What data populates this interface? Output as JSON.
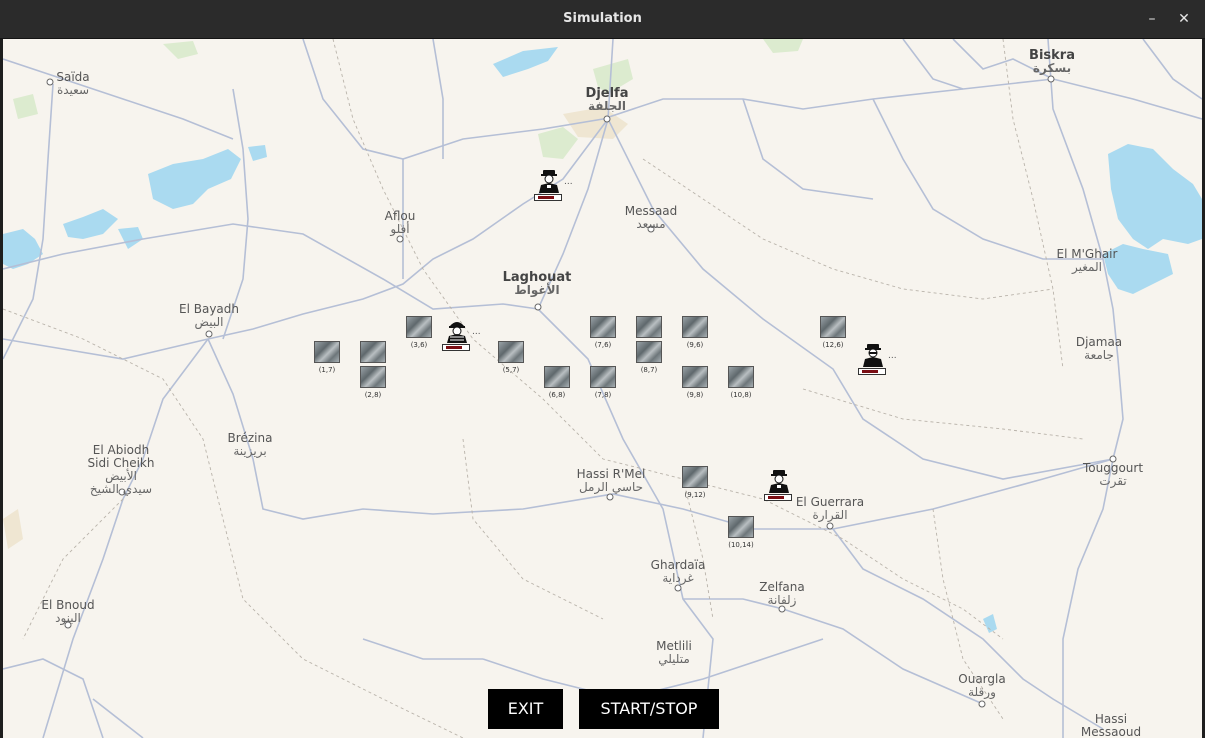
{
  "window": {
    "title": "Simulation",
    "minimize_icon": "–",
    "close_icon": "✕"
  },
  "buttons": {
    "exit": "EXIT",
    "start_stop": "START/STOP"
  },
  "cities": {
    "saida": {
      "name": "Saïda",
      "ar": "سعيدة"
    },
    "djelfa": {
      "name": "Djelfa",
      "ar": "الجلفة"
    },
    "biskra": {
      "name": "Biskra",
      "ar": "بسكرة"
    },
    "aflou": {
      "name": "Aflou",
      "ar": "أفلو"
    },
    "messaad": {
      "name": "Messaad",
      "ar": "مسعد"
    },
    "laghouat": {
      "name": "Laghouat",
      "ar": "الأغواط"
    },
    "elmghair": {
      "name": "El M'Ghair",
      "ar": "المغير"
    },
    "elbayadh": {
      "name": "El Bayadh",
      "ar": "البيض"
    },
    "djamaa": {
      "name": "Djamaa",
      "ar": "جامعة"
    },
    "elabiodh": {
      "name": "El Abiodh\nSidi Cheikh",
      "ar": "الأبيض\nسيدي الشيخ"
    },
    "brezina": {
      "name": "Brézina",
      "ar": "بريزينة"
    },
    "hassirmel": {
      "name": "Hassi R'Mel",
      "ar": "حاسي الرمل"
    },
    "touggourt": {
      "name": "Touggourt",
      "ar": "تقرت"
    },
    "elguerrara": {
      "name": "El Guerrara",
      "ar": "القرارة"
    },
    "ghardaia": {
      "name": "Ghardaïa",
      "ar": "غرداية"
    },
    "zelfana": {
      "name": "Zelfana",
      "ar": "زلفانة"
    },
    "elbnoud": {
      "name": "El Bnoud",
      "ar": "البنود"
    },
    "metlili": {
      "name": "Metlili",
      "ar": "متليلي"
    },
    "ouargla": {
      "name": "Ouargla",
      "ar": "ورقلة"
    },
    "hassimessaoud": {
      "name": "Hassi\nMessaoud",
      "ar": ""
    }
  },
  "tiles": [
    {
      "label": "(1,7)"
    },
    {
      "label": ""
    },
    {
      "label": "(2,8)"
    },
    {
      "label": "(3,6)"
    },
    {
      "label": "(5,7)"
    },
    {
      "label": "(6,8)"
    },
    {
      "label": "(7,6)"
    },
    {
      "label": "(7,8)"
    },
    {
      "label": ""
    },
    {
      "label": "(8,7)"
    },
    {
      "label": "(9,6)"
    },
    {
      "label": "(9,8)"
    },
    {
      "label": "(10,8)"
    },
    {
      "label": "(12,6)"
    },
    {
      "label": "(9,12)"
    },
    {
      "label": "(10,14)"
    }
  ],
  "agents": [
    {
      "type": "officer",
      "health": 0.8,
      "trail": "..."
    },
    {
      "type": "soldier",
      "health": 0.8,
      "trail": "..."
    },
    {
      "type": "officer",
      "health": 0.8,
      "trail": "..."
    },
    {
      "type": "officer",
      "health": 0.8,
      "trail": ""
    }
  ],
  "colors": {
    "land": "#f7f4ee",
    "road": "#b5bfd6",
    "water": "#aadaf0",
    "green": "#dcebcf",
    "health": "#7a0e14"
  }
}
